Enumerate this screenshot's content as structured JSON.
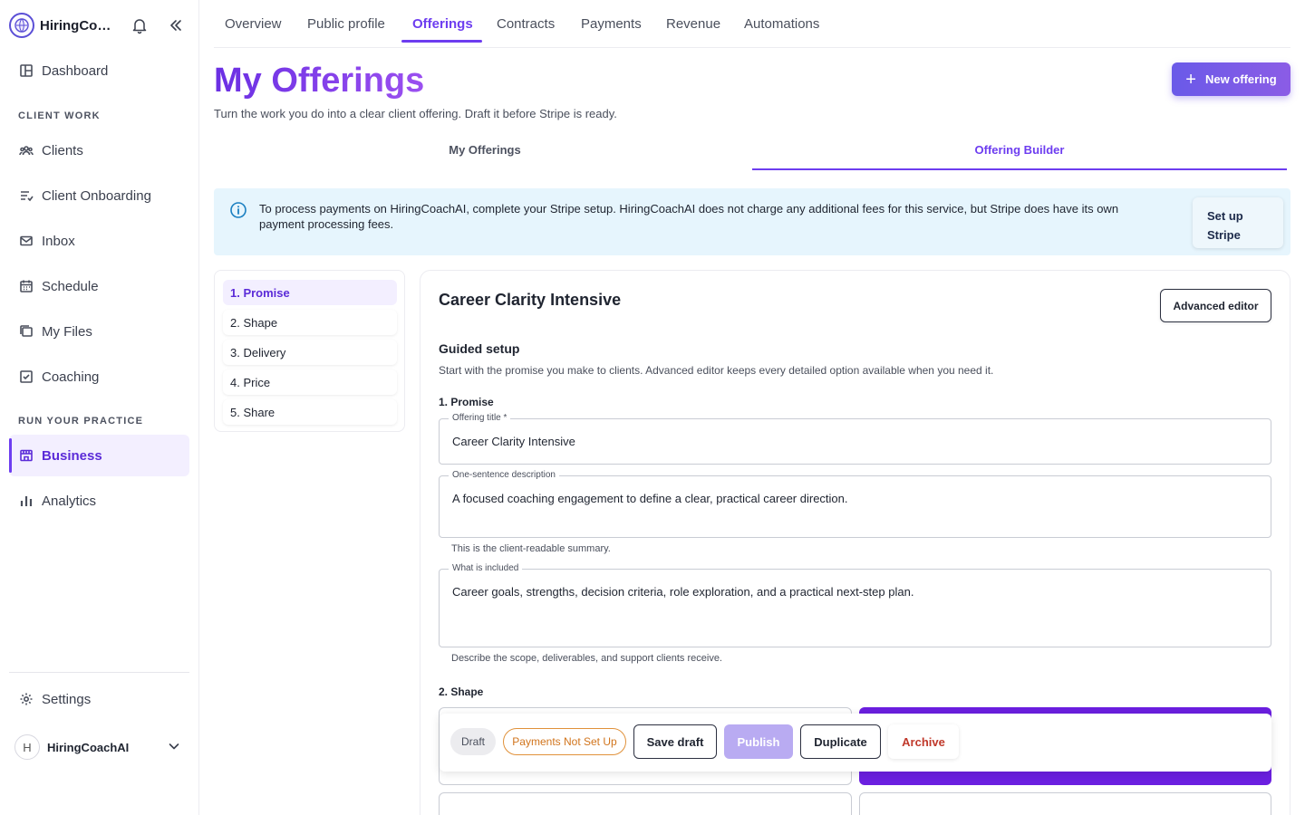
{
  "brand": {
    "name": "HiringCoachAI"
  },
  "sidebar": {
    "items": [
      {
        "id": "dashboard",
        "label": "Dashboard",
        "icon": "dashboard-icon"
      },
      {
        "id": "clients",
        "label": "Clients",
        "icon": "clients-icon"
      },
      {
        "id": "client-onboarding",
        "label": "Client Onboarding",
        "icon": "onboarding-icon"
      },
      {
        "id": "inbox",
        "label": "Inbox",
        "icon": "inbox-icon"
      },
      {
        "id": "schedule",
        "label": "Schedule",
        "icon": "calendar-icon"
      },
      {
        "id": "my-files",
        "label": "My Files",
        "icon": "files-icon"
      },
      {
        "id": "coaching",
        "label": "Coaching",
        "icon": "coaching-icon"
      },
      {
        "id": "business",
        "label": "Business",
        "icon": "storefront-icon",
        "active": true
      },
      {
        "id": "analytics",
        "label": "Analytics",
        "icon": "bar-chart-icon"
      },
      {
        "id": "settings",
        "label": "Settings",
        "icon": "gear-icon"
      }
    ],
    "sections": {
      "client_work": "CLIENT WORK",
      "run_practice": "RUN YOUR PRACTICE"
    },
    "account": {
      "initial": "H",
      "name": "HiringCoachAI"
    }
  },
  "top_tabs": [
    "Overview",
    "Public profile",
    "Offerings",
    "Contracts",
    "Payments",
    "Revenue",
    "Automations"
  ],
  "active_top_tab": "Offerings",
  "header": {
    "title": "My Offerings",
    "subtitle": "Turn the work you do into a clear client offering. Draft it before Stripe is ready.",
    "new_button": "New offering"
  },
  "sub_tabs": [
    "My Offerings",
    "Offering Builder"
  ],
  "active_sub_tab": "Offering Builder",
  "banner": {
    "text": "To process payments on HiringCoachAI, complete your Stripe setup. HiringCoachAI does not charge any additional fees for this service, but Stripe does have its own payment processing fees.",
    "button": "Set up Stripe"
  },
  "steps": [
    "1. Promise",
    "2. Shape",
    "3. Delivery",
    "4. Price",
    "5. Share"
  ],
  "active_step": "1. Promise",
  "builder": {
    "title": "Career Clarity Intensive",
    "advanced_button": "Advanced editor",
    "guided_title": "Guided setup",
    "guided_desc": "Start with the promise you make to clients. Advanced editor keeps every detailed option available when you need it.",
    "promise_heading": "1. Promise",
    "shape_heading": "2. Shape",
    "fields": {
      "title": {
        "label": "Offering title *",
        "value": "Career Clarity Intensive"
      },
      "description": {
        "label": "One-sentence description",
        "value": "A focused coaching engagement to define a clear, practical career direction.",
        "helper": "This is the client-readable summary."
      },
      "included": {
        "label": "What is included",
        "value": "Career goals, strengths, decision criteria, role exploration, and a practical next-step plan.",
        "helper": "Describe the scope, deliverables, and support clients receive."
      }
    }
  },
  "actions": {
    "status": "Draft",
    "payment_status": "Payments Not Set Up",
    "save": "Save draft",
    "publish": "Publish",
    "duplicate": "Duplicate",
    "archive": "Archive"
  },
  "colors": {
    "accent": "#6d3df0",
    "banner_bg": "#e6f5fd",
    "warning": "#d1741c",
    "danger": "#c0392b"
  }
}
